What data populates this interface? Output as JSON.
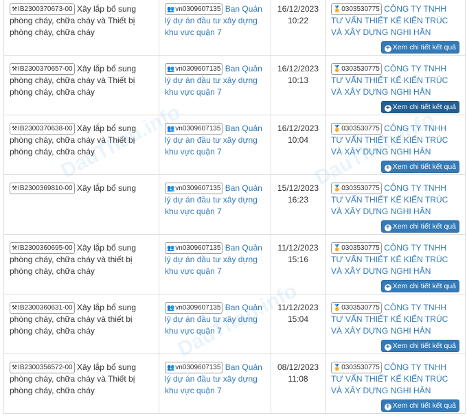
{
  "buttonLabel": "Xem chi tiết kết quả",
  "watermark": "DauThau.info",
  "rows": [
    {
      "code": "IB2300370673-00",
      "title": "Xây lắp bổ sung phòng cháy, chữa cháy và Thiết bị phòng cháy, chữa cháy",
      "investorCode": "vn0309607135",
      "investorName": "Ban Quản lý dự án đầu tư xây dựng khu vực quận 7",
      "date": "16/12/2023",
      "time": "10:22",
      "winnerCode": "0303530775",
      "winnerName": "CÔNG TY TNHH TƯ VẤN THIẾT KẾ KIẾN TRÚC VÀ XÂY DỰNG NGHI HÂN"
    },
    {
      "code": "IB2300370657-00",
      "title": "Xây lắp bổ sung phòng cháy, chữa cháy và Thiết bị phòng cháy, chữa cháy",
      "investorCode": "vn0309607135",
      "investorName": "Ban Quản lý dự án đầu tư xây dựng khu vực quận 7",
      "date": "16/12/2023",
      "time": "10:13",
      "winnerCode": "0303530775",
      "winnerName": "CÔNG TY TNHH TƯ VẤN THIẾT KẾ KIẾN TRÚC VÀ XÂY DỰNG NGHI HÂN"
    },
    {
      "code": "IB2300370638-00",
      "title": "Xây lắp bổ sung phòng cháy, chữa cháy và Thiết bị phòng cháy, chữa cháy",
      "investorCode": "vn0309607135",
      "investorName": "Ban Quản lý dự án đầu tư xây dựng khu vực quận 7",
      "date": "16/12/2023",
      "time": "10:04",
      "winnerCode": "0303530775",
      "winnerName": "CÔNG TY TNHH TƯ VẤN THIẾT KẾ KIẾN TRÚC VÀ XÂY DỰNG NGHI HÂN"
    },
    {
      "code": "IB2300369810-00",
      "title": "Xây lắp bổ sung",
      "investorCode": "vn0309607135",
      "investorName": "Ban Quản lý dự án đầu tư xây dựng khu vực quận 7",
      "date": "15/12/2023",
      "time": "16:23",
      "winnerCode": "0303530775",
      "winnerName": "CÔNG TY TNHH TƯ VẤN THIẾT KẾ KIẾN TRÚC VÀ XÂY DỰNG NGHI HÂN"
    },
    {
      "code": "IB2300360695-00",
      "title": "Xây lắp bổ sung phòng cháy, chữa cháy và thiết bị phòng cháy, chữa cháy",
      "investorCode": "vn0309607135",
      "investorName": "Ban Quản lý dự án đầu tư xây dựng khu vực quận 7",
      "date": "11/12/2023",
      "time": "15:16",
      "winnerCode": "0303530775",
      "winnerName": "CÔNG TY TNHH TƯ VẤN THIẾT KẾ KIẾN TRÚC VÀ XÂY DỰNG NGHI HÂN"
    },
    {
      "code": "IB2300360631-00",
      "title": "Xây lắp bổ sung phòng cháy, chữa cháy và thiết bị phòng cháy, chữa cháy",
      "investorCode": "vn0309607135",
      "investorName": "Ban Quản lý dự án đầu tư xây dựng khu vực quận 7",
      "date": "11/12/2023",
      "time": "15:04",
      "winnerCode": "0303530775",
      "winnerName": "CÔNG TY TNHH TƯ VẤN THIẾT KẾ KIẾN TRÚC VÀ XÂY DỰNG NGHI HÂN"
    },
    {
      "code": "IB2300356572-00",
      "title": "Xây lắp bổ sung phòng cháy, chữa cháy và Thiết bị phòng cháy, chữa cháy",
      "investorCode": "vn0309607135",
      "investorName": "Ban Quản lý dự án đầu tư xây dựng khu vực quận 7",
      "date": "08/12/2023",
      "time": "11:08",
      "winnerCode": "0303530775",
      "winnerName": "CÔNG TY TNHH TƯ VẤN THIẾT KẾ KIẾN TRÚC VÀ XÂY DỰNG NGHI HÂN"
    }
  ]
}
